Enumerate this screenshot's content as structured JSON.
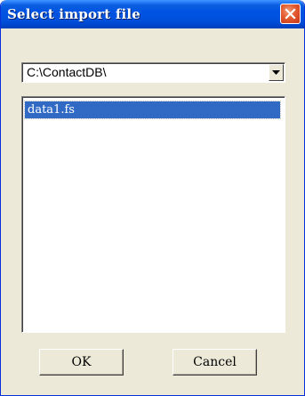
{
  "window": {
    "title": "Select import file",
    "close_icon": "close-icon"
  },
  "directory": {
    "selected": "C:\\ContactDB\\",
    "dropdown_icon": "chevron-down-icon"
  },
  "files": [
    {
      "name": "data1.fs",
      "selected": true
    }
  ],
  "buttons": {
    "ok": "OK",
    "cancel": "Cancel"
  },
  "colors": {
    "titlebar": "#0054e3",
    "close_button": "#e35a2e",
    "selection": "#316ac5",
    "dialog_bg": "#ece9d8"
  }
}
